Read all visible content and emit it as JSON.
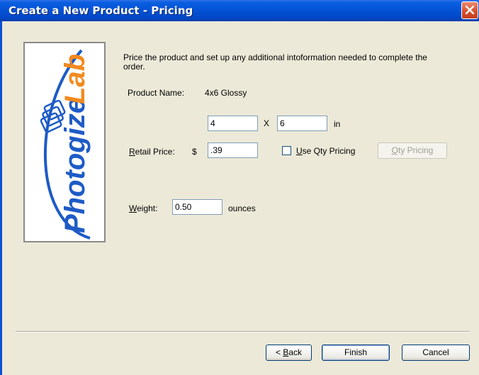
{
  "window": {
    "title": "Create a New Product - Pricing",
    "close_icon": "close-icon",
    "colors": {
      "titlebar": "#0553d6",
      "close": "#d8512f",
      "face": "#ece9d8",
      "logo_blue": "#1e5bc6",
      "logo_orange": "#f28a1e"
    }
  },
  "logo": {
    "text_main": "Photogize",
    "text_accent": "Lab"
  },
  "intro_text": "Price the product and set up any additional intoformation needed to complete the order.",
  "product": {
    "name_label": "Product Name:",
    "name_value": "4x6 Glossy"
  },
  "size": {
    "width": "4",
    "times": "X",
    "height": "6",
    "unit": "in"
  },
  "retail": {
    "label_mnemonic": "R",
    "label_rest": "etail Price:",
    "currency": "$",
    "value": ".39"
  },
  "qty": {
    "checkbox_mnemonic": "U",
    "checkbox_rest": "se Qty Pricing",
    "checked": false,
    "button_mnemonic": "Q",
    "button_rest": "ty Pricing"
  },
  "weight": {
    "label_mnemonic": "W",
    "label_rest": "eight:",
    "value": "0.50",
    "unit": "ounces"
  },
  "buttons": {
    "back_prefix": "< ",
    "back_mnemonic": "B",
    "back_rest": "ack",
    "finish": "Finish",
    "cancel": "Cancel"
  }
}
